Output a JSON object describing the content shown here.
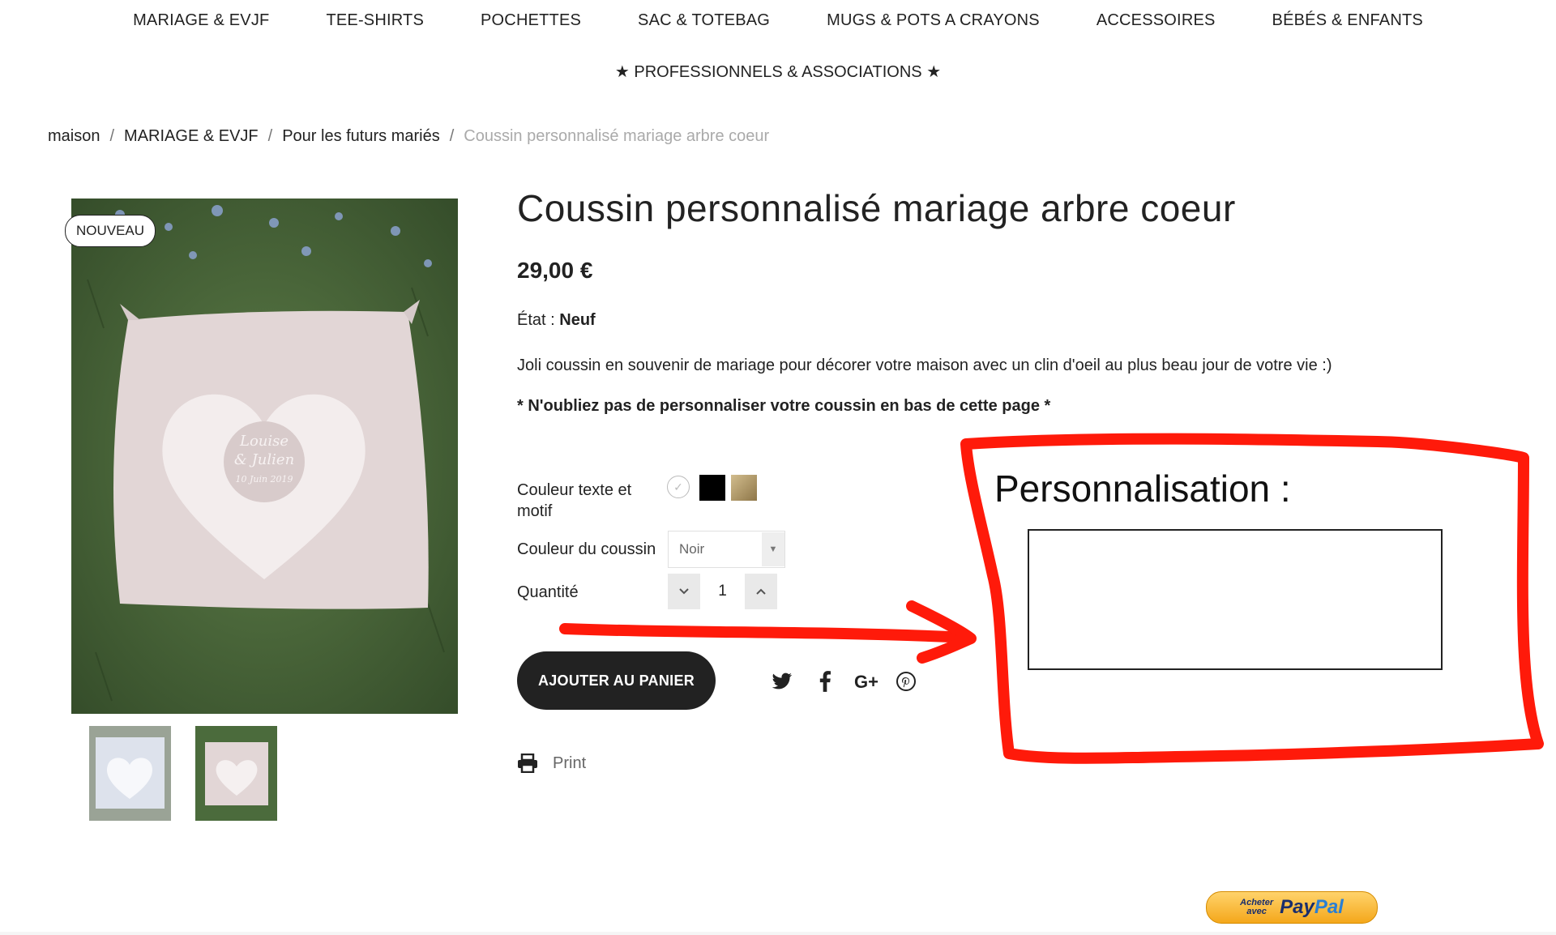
{
  "nav": {
    "items": [
      "MARIAGE & EVJF",
      "TEE-SHIRTS",
      "POCHETTES",
      "SAC & TOTEBAG",
      "MUGS & POTS A CRAYONS",
      "ACCESSOIRES",
      "BÉBÉS & ENFANTS"
    ],
    "pro": "★ PROFESSIONNELS & ASSOCIATIONS ★"
  },
  "breadcrumb": {
    "home": "maison",
    "cat": "MARIAGE & EVJF",
    "sub": "Pour les futurs mariés",
    "current": "Coussin personnalisé mariage arbre coeur"
  },
  "product": {
    "badge": "NOUVEAU",
    "title": "Coussin personnalisé mariage arbre coeur",
    "price": "29,00 €",
    "condition_label": "État :",
    "condition_value": "Neuf",
    "description": "Joli coussin en souvenir de mariage pour décorer votre maison avec un clin d'oeil au plus beau jour de votre vie :)",
    "note": "* N'oubliez pas de personnaliser votre coussin en bas de cette page *",
    "image_text": {
      "names_1": "Louise",
      "names_2": "& Julien",
      "date": "10 Juin 2019"
    }
  },
  "options": {
    "color_label_1": "Couleur texte et",
    "color_label_2": "motif",
    "swatch_colors": [
      "#ffffff",
      "#000000",
      "#b59b6a"
    ],
    "cushion_label": "Couleur du coussin",
    "cushion_value": "Noir",
    "qty_label": "Quantité",
    "qty_value": "1"
  },
  "actions": {
    "add_to_cart": "AJOUTER AU PANIER",
    "print": "Print"
  },
  "social": [
    "twitter-icon",
    "facebook-icon",
    "google-plus-icon",
    "pinterest-icon"
  ],
  "personalization": {
    "title": "Personnalisation :"
  },
  "paypal": {
    "small_1": "Acheter",
    "small_2": "avec",
    "brand_pay": "Pay",
    "brand_pal": "Pal"
  },
  "colors": {
    "annotation": "#ff1a0a",
    "text": "#222222",
    "button": "#222222"
  }
}
